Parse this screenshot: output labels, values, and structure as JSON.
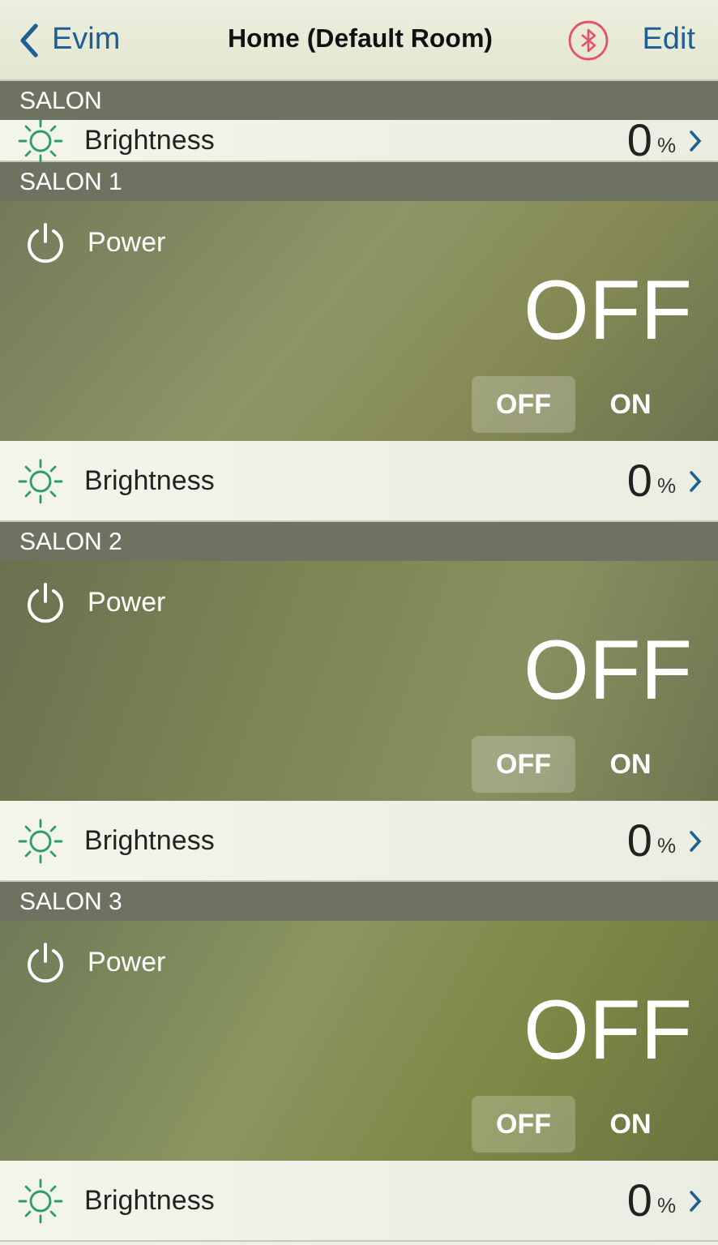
{
  "nav": {
    "back": "Evim",
    "title": "Home (Default Room)",
    "edit": "Edit"
  },
  "sections": [
    {
      "title": "SALON",
      "clipped": true,
      "brightness": {
        "label": "Brightness",
        "value": "0",
        "unit": "%"
      }
    },
    {
      "title": "SALON 1",
      "clipped": false,
      "power": {
        "label": "Power",
        "state": "OFF",
        "options": [
          {
            "label": "OFF",
            "selected": true
          },
          {
            "label": "ON",
            "selected": false
          }
        ]
      },
      "brightness": {
        "label": "Brightness",
        "value": "0",
        "unit": "%"
      }
    },
    {
      "title": "SALON 2",
      "clipped": false,
      "power": {
        "label": "Power",
        "state": "OFF",
        "options": [
          {
            "label": "OFF",
            "selected": true
          },
          {
            "label": "ON",
            "selected": false
          }
        ]
      },
      "brightness": {
        "label": "Brightness",
        "value": "0",
        "unit": "%"
      }
    },
    {
      "title": "SALON 3",
      "clipped": false,
      "power": {
        "label": "Power",
        "state": "OFF",
        "options": [
          {
            "label": "OFF",
            "selected": true
          },
          {
            "label": "ON",
            "selected": false
          }
        ]
      },
      "brightness": {
        "label": "Brightness",
        "value": "0",
        "unit": "%"
      }
    }
  ]
}
